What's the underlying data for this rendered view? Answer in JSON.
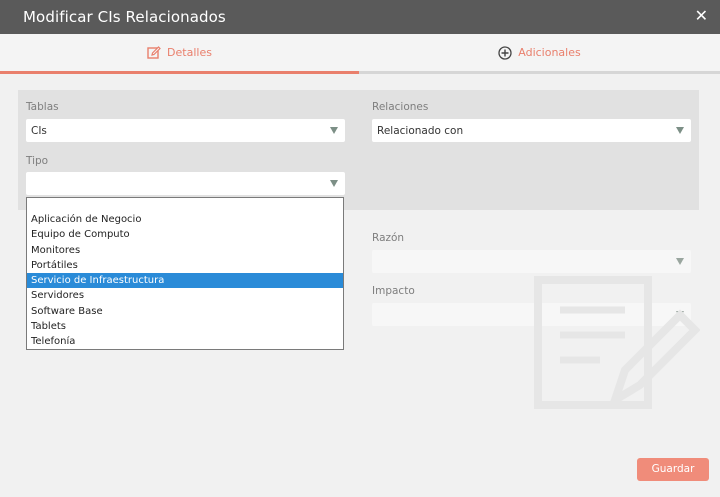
{
  "dialog": {
    "title": "Modificar CIs Relacionados",
    "close_glyph": "✕"
  },
  "tabs": [
    {
      "label": "Detalles",
      "icon": "edit-icon",
      "active": true
    },
    {
      "label": "Adicionales",
      "icon": "plus-circle-icon",
      "active": false
    }
  ],
  "form": {
    "tablas": {
      "label": "Tablas",
      "value": "CIs"
    },
    "relaciones": {
      "label": "Relaciones",
      "value": "Relacionado con"
    },
    "tipo": {
      "label": "Tipo",
      "value": ""
    },
    "razon": {
      "label": "Razón",
      "value": ""
    },
    "impacto": {
      "label": "Impacto",
      "value": ""
    }
  },
  "tipo_dropdown": {
    "options": [
      "Aplicación de Negocio",
      "Equipo de Computo",
      "Monitores",
      "Portátiles",
      "Servicio de Infraestructura",
      "Servidores",
      "Software Base",
      "Tablets",
      "Telefonía"
    ],
    "highlighted": "Servicio de Infraestructura"
  },
  "actions": {
    "save_label": "Guardar"
  },
  "colors": {
    "accent": "#e97f6c",
    "titlebar": "#5a5a5a",
    "highlight": "#2a8bd8",
    "button": "#f08c7a"
  }
}
